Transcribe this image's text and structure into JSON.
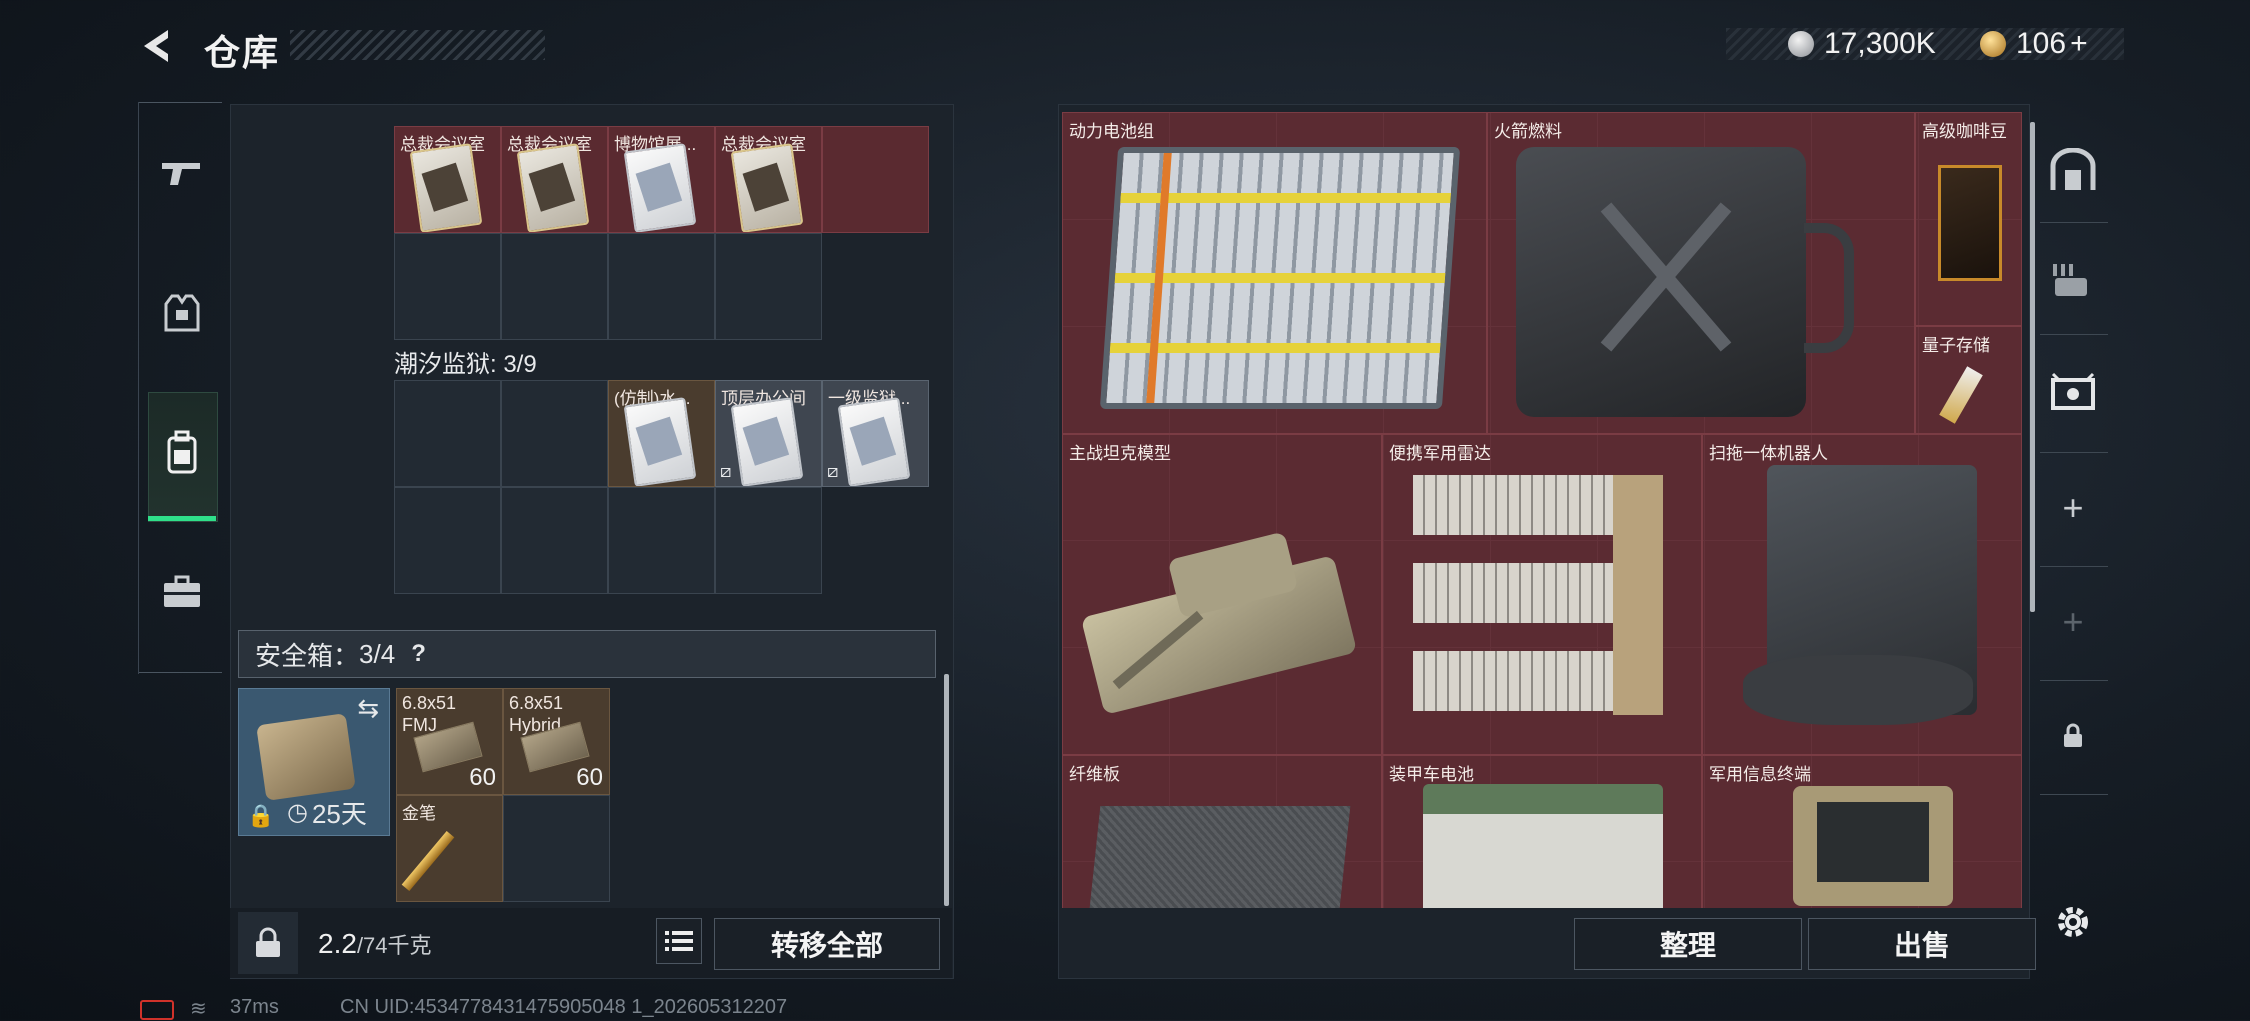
{
  "header": {
    "back_icon": "back-arrow-icon",
    "title": "仓库",
    "currencies": [
      {
        "icon": "silver-coin-icon",
        "value": "17,300K",
        "color": "#c9ccd0"
      },
      {
        "icon": "gold-coin-icon",
        "value": "106",
        "plus": "+",
        "color": "#d6a347"
      }
    ]
  },
  "left_rail": [
    {
      "icon": "gun-icon",
      "active": false
    },
    {
      "icon": "armor-vest-icon",
      "active": false
    },
    {
      "icon": "backpack-icon",
      "active": true
    },
    {
      "icon": "briefcase-icon",
      "active": false
    }
  ],
  "containers": [
    {
      "title": "",
      "slots": [
        {
          "label": "总裁会议室",
          "color": "red",
          "item": "gold-keycard"
        },
        {
          "label": "总裁会议室",
          "color": "red",
          "item": "gold-keycard"
        },
        {
          "label": "博物馆展...",
          "color": "red",
          "item": "white-keycard"
        },
        {
          "label": "总裁会议室",
          "color": "red",
          "item": "gold-keycard"
        }
      ]
    },
    {
      "title": "潮汐监狱: 3/9",
      "slots": [
        {
          "label": "(仿制)水...",
          "color": "brown",
          "item": "white-keycard",
          "unlinked": false
        },
        {
          "label": "顶层办公间",
          "color": "grey",
          "item": "white-keycard",
          "unlinked": true
        },
        {
          "label": "一级监狱...",
          "color": "grey",
          "item": "white-keycard",
          "unlinked": true
        }
      ]
    }
  ],
  "safe_box": {
    "label": "安全箱",
    "separator": "：",
    "count": "3/4",
    "help": "?",
    "duration": "25天",
    "swap_icon": "swap-icon",
    "lock_icon": "lock-icon",
    "clock_icon": "clock-icon",
    "items": [
      {
        "label": "6.8x51\nFMJ",
        "count": "60"
      },
      {
        "label": "6.8x51\nHybrid",
        "count": "60"
      },
      {
        "label": "金笔",
        "count": ""
      }
    ]
  },
  "footer_left": {
    "weight_current": "2.2",
    "weight_max": "/74千克",
    "list_icon": "list-icon",
    "transfer_all": "转移全部"
  },
  "warehouse_items": [
    {
      "name": "动力电池组"
    },
    {
      "name": "火箭燃料"
    },
    {
      "name": "高级咖啡豆"
    },
    {
      "name": "量子存储"
    },
    {
      "name": "主战坦克模型"
    },
    {
      "name": "便携军用雷达"
    },
    {
      "name": "扫拖一体机器人"
    },
    {
      "name": "纤维板"
    },
    {
      "name": "装甲车电池"
    },
    {
      "name": "军用信息终端"
    }
  ],
  "footer_right": {
    "sort": "整理",
    "sell": "出售"
  },
  "right_rail": [
    {
      "icon": "stash-vault-icon"
    },
    {
      "icon": "weapon-rack-icon"
    },
    {
      "icon": "display-case-icon"
    },
    {
      "icon": "add-icon",
      "text": "+"
    },
    {
      "icon": "add-disabled-icon",
      "text": "+"
    },
    {
      "icon": "lock-icon"
    },
    {
      "icon": "gear-icon"
    }
  ],
  "status_bar": {
    "ping": "37ms",
    "uid": "CN UID:4534778431475905048 1_202605312207"
  }
}
